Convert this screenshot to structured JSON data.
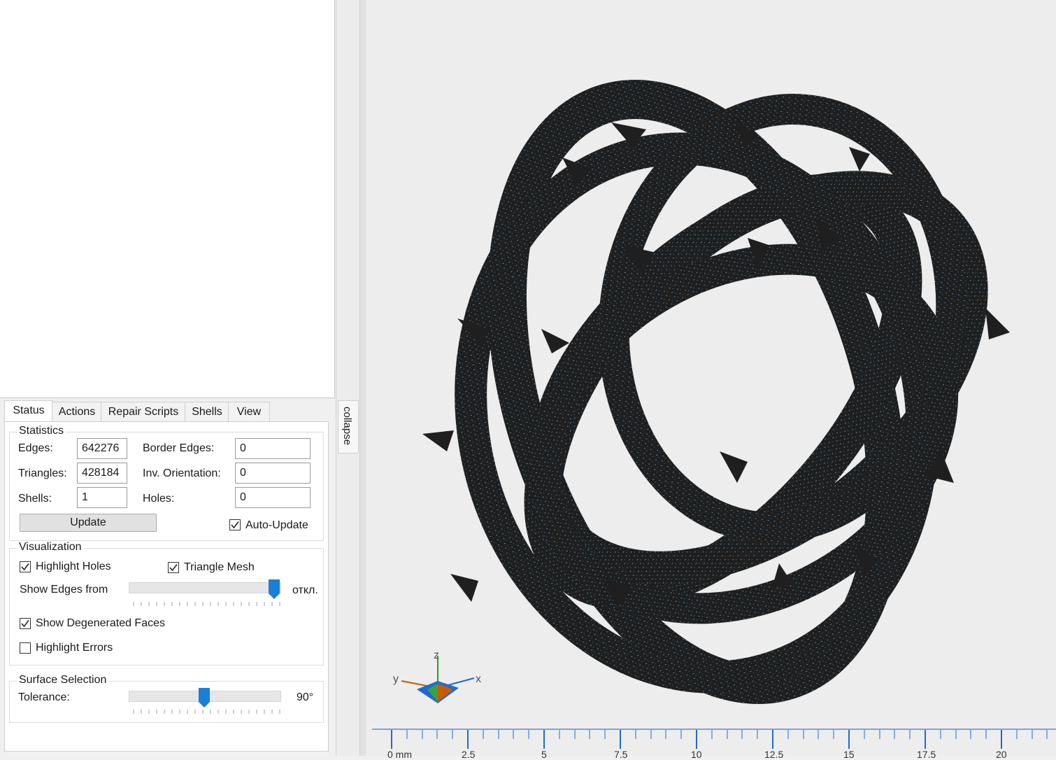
{
  "tabs": [
    {
      "label": "Status",
      "active": true
    },
    {
      "label": "Actions",
      "active": false
    },
    {
      "label": "Repair Scripts",
      "active": false
    },
    {
      "label": "Shells",
      "active": false
    },
    {
      "label": "View",
      "active": false
    }
  ],
  "collapse_label": "collapse",
  "statistics": {
    "title": "Statistics",
    "edges_label": "Edges:",
    "edges_value": "642276",
    "triangles_label": "Triangles:",
    "triangles_value": "428184",
    "shells_label": "Shells:",
    "shells_value": "1",
    "border_edges_label": "Border Edges:",
    "border_edges_value": "0",
    "inv_orientation_label": "Inv. Orientation:",
    "inv_orientation_value": "0",
    "holes_label": "Holes:",
    "holes_value": "0",
    "update_label": "Update",
    "auto_update_label": "Auto-Update",
    "auto_update_checked": true
  },
  "visualization": {
    "title": "Visualization",
    "highlight_holes_label": "Highlight Holes",
    "highlight_holes_checked": true,
    "triangle_mesh_label": "Triangle Mesh",
    "triangle_mesh_checked": true,
    "show_edges_label": "Show Edges from",
    "show_edges_value_label": "откл.",
    "show_edges_level": 1.0,
    "degenerated_label": "Show Degenerated Faces",
    "degenerated_checked": true,
    "highlight_errors_label": "Highlight Errors",
    "highlight_errors_checked": false
  },
  "surface_selection": {
    "title": "Surface Selection",
    "tolerance_label": "Tolerance:",
    "tolerance_value": "90°",
    "tolerance_level": 0.5
  },
  "axis_labels": {
    "x": "x",
    "y": "y",
    "z": "z"
  },
  "ruler_labels": [
    "0 mm",
    "2.5",
    "5",
    "7.5",
    "10",
    "12.5",
    "15",
    "17.5",
    "20"
  ],
  "colors": {
    "mesh": "#1f1f1f",
    "mesh_speckle": "#5b86a8",
    "accent": "#1a7fd6"
  }
}
